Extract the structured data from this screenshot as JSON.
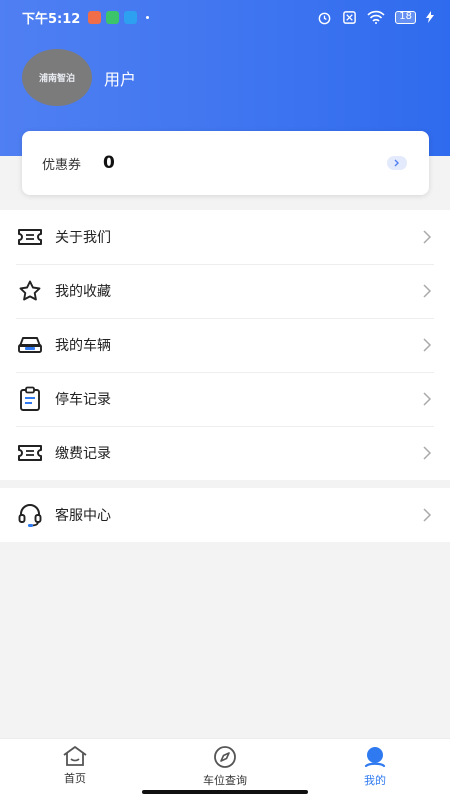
{
  "status_bar": {
    "time": "下午5:12",
    "battery": "18"
  },
  "profile": {
    "username": "用户",
    "logo_text": "浦南智泊"
  },
  "coupon": {
    "label": "优惠券",
    "value": "0"
  },
  "menu": [
    {
      "label": "关于我们",
      "icon": "ticket-icon"
    },
    {
      "label": "我的收藏",
      "icon": "star-icon"
    },
    {
      "label": "我的车辆",
      "icon": "car-icon"
    },
    {
      "label": "停车记录",
      "icon": "clipboard-icon"
    },
    {
      "label": "缴费记录",
      "icon": "ticket-icon"
    }
  ],
  "service": {
    "label": "客服中心",
    "icon": "headset-icon"
  },
  "bottom_nav": [
    {
      "label": "首页",
      "icon": "home-icon",
      "active": false
    },
    {
      "label": "车位查询",
      "icon": "compass-icon",
      "active": false
    },
    {
      "label": "我的",
      "icon": "user-icon",
      "active": true
    }
  ],
  "colors": {
    "primary": "#3f75f0",
    "active_nav": "#2f7af0",
    "icon_dark": "#222222"
  }
}
